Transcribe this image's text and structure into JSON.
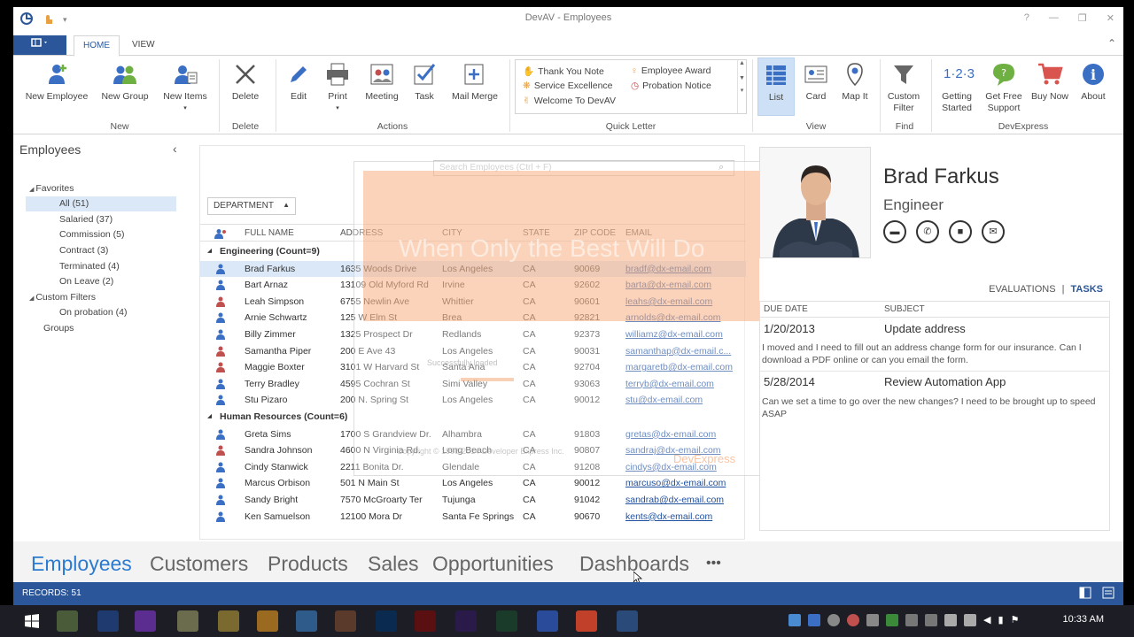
{
  "window": {
    "title": "DevAV - Employees"
  },
  "ribbon": {
    "tabs": {
      "file": "",
      "home": "HOME",
      "view": "VIEW"
    },
    "buttons": {
      "new_employee": "New Employee",
      "new_group": "New Group",
      "new_items": "New Items",
      "delete": "Delete",
      "edit": "Edit",
      "print": "Print",
      "meeting": "Meeting",
      "task": "Task",
      "mail_merge": "Mail Merge",
      "list": "List",
      "card": "Card",
      "map_it": "Map It",
      "custom_filter": "Custom Filter",
      "getting_started": "Getting Started",
      "free_support": "Get Free Support",
      "buy_now": "Buy Now",
      "about": "About"
    },
    "groups": {
      "new": "New",
      "delete": "Delete",
      "actions": "Actions",
      "quick_letter": "Quick Letter",
      "view": "View",
      "find": "Find",
      "devexpress": "DevExpress"
    },
    "quick_letter": {
      "thank_you": "Thank You Note",
      "award": "Employee Award",
      "service": "Service Excellence",
      "probation": "Probation Notice",
      "welcome": "Welcome To DevAV"
    }
  },
  "nav": {
    "title": "Employees",
    "tree": {
      "favorites": "Favorites",
      "all": "All (51)",
      "salaried": "Salaried (37)",
      "commission": "Commission (5)",
      "contract": "Contract (3)",
      "terminated": "Terminated (4)",
      "on_leave": "On Leave (2)",
      "custom_filters": "Custom Filters",
      "on_probation": "On probation (4)",
      "groups": "Groups"
    }
  },
  "grid": {
    "search_placeholder": "Search Employees (Ctrl + F)",
    "group_by": "DEPARTMENT",
    "headers": {
      "name": "FULL NAME",
      "address": "ADDRESS",
      "city": "CITY",
      "state": "STATE",
      "zip": "ZIP CODE",
      "email": "EMAIL"
    },
    "groups": [
      {
        "label": "Engineering (Count=9)",
        "rows": [
          {
            "name": "Brad Farkus",
            "address": "1635 Woods Drive",
            "city": "Los Angeles",
            "state": "CA",
            "zip": "90069",
            "email": "bradf@dx-email.com",
            "color": "#3a6fc4"
          },
          {
            "name": "Bart Arnaz",
            "address": "13109 Old Myford Rd",
            "city": "Irvine",
            "state": "CA",
            "zip": "92602",
            "email": "barta@dx-email.com",
            "color": "#3a6fc4"
          },
          {
            "name": "Leah Simpson",
            "address": "6755 Newlin Ave",
            "city": "Whittier",
            "state": "CA",
            "zip": "90601",
            "email": "leahs@dx-email.com",
            "color": "#c0504d"
          },
          {
            "name": "Arnie Schwartz",
            "address": "125 W Elm St",
            "city": "Brea",
            "state": "CA",
            "zip": "92821",
            "email": "arnolds@dx-email.com",
            "color": "#3a6fc4"
          },
          {
            "name": "Billy Zimmer",
            "address": "1325 Prospect Dr",
            "city": "Redlands",
            "state": "CA",
            "zip": "92373",
            "email": "williamz@dx-email.com",
            "color": "#3a6fc4"
          },
          {
            "name": "Samantha Piper",
            "address": "200 E Ave 43",
            "city": "Los Angeles",
            "state": "CA",
            "zip": "90031",
            "email": "samanthap@dx-email.c...",
            "color": "#c0504d"
          },
          {
            "name": "Maggie Boxter",
            "address": "3101 W Harvard St",
            "city": "Santa Ana",
            "state": "CA",
            "zip": "92704",
            "email": "margaretb@dx-email.com",
            "color": "#c0504d"
          },
          {
            "name": "Terry Bradley",
            "address": "4595 Cochran St",
            "city": "Simi Valley",
            "state": "CA",
            "zip": "93063",
            "email": "terryb@dx-email.com",
            "color": "#3a6fc4"
          },
          {
            "name": "Stu Pizaro",
            "address": "200 N. Spring St",
            "city": "Los Angeles",
            "state": "CA",
            "zip": "90012",
            "email": "stu@dx-email.com",
            "color": "#3a6fc4"
          }
        ]
      },
      {
        "label": "Human Resources (Count=6)",
        "rows": [
          {
            "name": "Greta Sims",
            "address": "1700 S Grandview Dr.",
            "city": "Alhambra",
            "state": "CA",
            "zip": "91803",
            "email": "gretas@dx-email.com",
            "color": "#3a6fc4"
          },
          {
            "name": "Sandra Johnson",
            "address": "4600 N Virginia Rd.",
            "city": "Long Beach",
            "state": "CA",
            "zip": "90807",
            "email": "sandraj@dx-email.com",
            "color": "#c0504d"
          },
          {
            "name": "Cindy Stanwick",
            "address": "2211 Bonita Dr.",
            "city": "Glendale",
            "state": "CA",
            "zip": "91208",
            "email": "cindys@dx-email.com",
            "color": "#3a6fc4"
          },
          {
            "name": "Marcus Orbison",
            "address": "501 N Main St",
            "city": "Los Angeles",
            "state": "CA",
            "zip": "90012",
            "email": "marcuso@dx-email.com",
            "color": "#3a6fc4"
          },
          {
            "name": "Sandy Bright",
            "address": "7570 McGroarty Ter",
            "city": "Tujunga",
            "state": "CA",
            "zip": "91042",
            "email": "sandrab@dx-email.com",
            "color": "#3a6fc4"
          },
          {
            "name": "Ken Samuelson",
            "address": "12100 Mora Dr",
            "city": "Santa Fe Springs",
            "state": "CA",
            "zip": "90670",
            "email": "kents@dx-email.com",
            "color": "#3a6fc4"
          }
        ]
      }
    ]
  },
  "splash": {
    "tagline": "When Only the Best Will Do",
    "status": "Successfully loaded",
    "copyright": "Copyright © 1998-2014 Developer Express Inc.",
    "brand": "DevExpress"
  },
  "detail": {
    "name": "Brad Farkus",
    "title": "Engineer",
    "tabs": {
      "evaluations": "EVALUATIONS",
      "sep": "|",
      "tasks": "TASKS"
    },
    "task_headers": {
      "due": "DUE DATE",
      "subject": "SUBJECT"
    },
    "tasks": [
      {
        "date": "1/20/2013",
        "subject": "Update address",
        "note": "I moved and I need to fill out an address change form for our insurance. Can I download a PDF online or can you email the form."
      },
      {
        "date": "5/28/2014",
        "subject": "Review Automation App",
        "note": "Can we set a time to go over the new changes? I need to be brought up to speed ASAP"
      }
    ]
  },
  "bottom_nav": {
    "employees": "Employees",
    "customers": "Customers",
    "products": "Products",
    "sales": "Sales",
    "opportunities": "Opportunities",
    "dashboards": "Dashboards",
    "more": "•••"
  },
  "status": {
    "records": "RECORDS: 51"
  },
  "taskbar": {
    "time": "10:33 AM"
  },
  "colors": {
    "accent": "#2b579a",
    "active_nav": "#2b7bd0",
    "selection": "#dbe8f7"
  }
}
